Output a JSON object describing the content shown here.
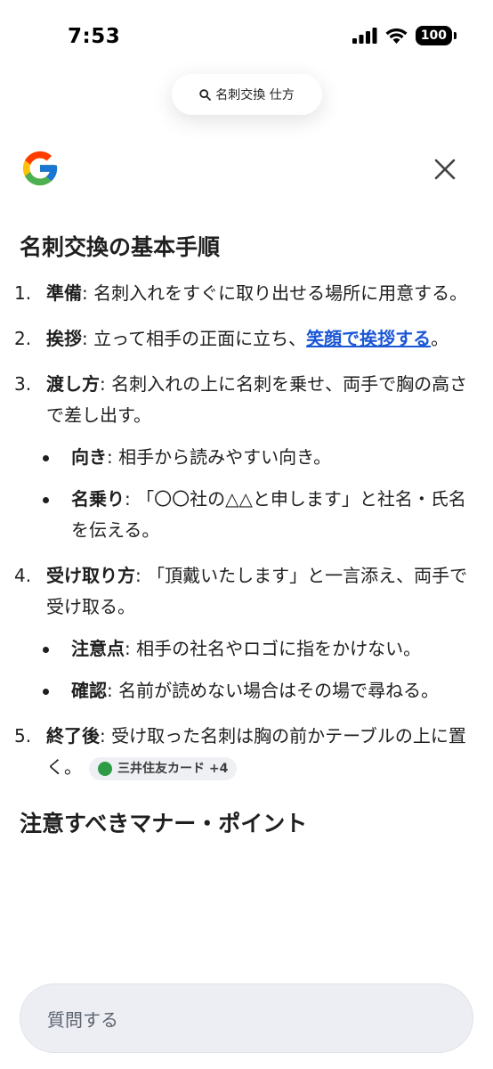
{
  "status": {
    "time": "7:53",
    "battery": "100"
  },
  "search": {
    "query": "名刺交換 仕方"
  },
  "answer": {
    "heading": "名刺交換の基本手順",
    "steps": [
      {
        "num": "1.",
        "term": "準備",
        "text": ": 名刺入れをすぐに取り出せる場所に用意する。"
      },
      {
        "num": "2.",
        "term": "挨拶",
        "text": ": 立って相手の正面に立ち、",
        "link": "笑顔で挨拶する",
        "after": "。"
      },
      {
        "num": "3.",
        "term": "渡し方",
        "text": ": 名刺入れの上に名刺を乗せ、両手で胸の高さで差し出す。",
        "sub": [
          {
            "term": "向き",
            "text": ": 相手から読みやすい向き。"
          },
          {
            "term": "名乗り",
            "text": ": 「〇〇社の△△と申します」と社名・氏名を伝える。"
          }
        ]
      },
      {
        "num": "4.",
        "term": "受け取り方",
        "text": ": 「頂戴いたします」と一言添え、両手で受け取る。",
        "sub": [
          {
            "term": "注意点",
            "text": ": 相手の社名やロゴに指をかけない。"
          },
          {
            "term": "確認",
            "text": ": 名前が読めない場合はその場で尋ねる。"
          }
        ]
      },
      {
        "num": "5.",
        "term": "終了後",
        "text": ": 受け取った名刺は胸の前かテーブルの上に置く。",
        "source": "三井住友カード +4"
      }
    ],
    "heading2": "注意すべきマナー・ポイント"
  },
  "ask": {
    "placeholder": "質問する"
  },
  "colors": {
    "link": "#1a56d6",
    "chip_bg": "#eef0f4",
    "ask_bg": "#eceef3"
  }
}
